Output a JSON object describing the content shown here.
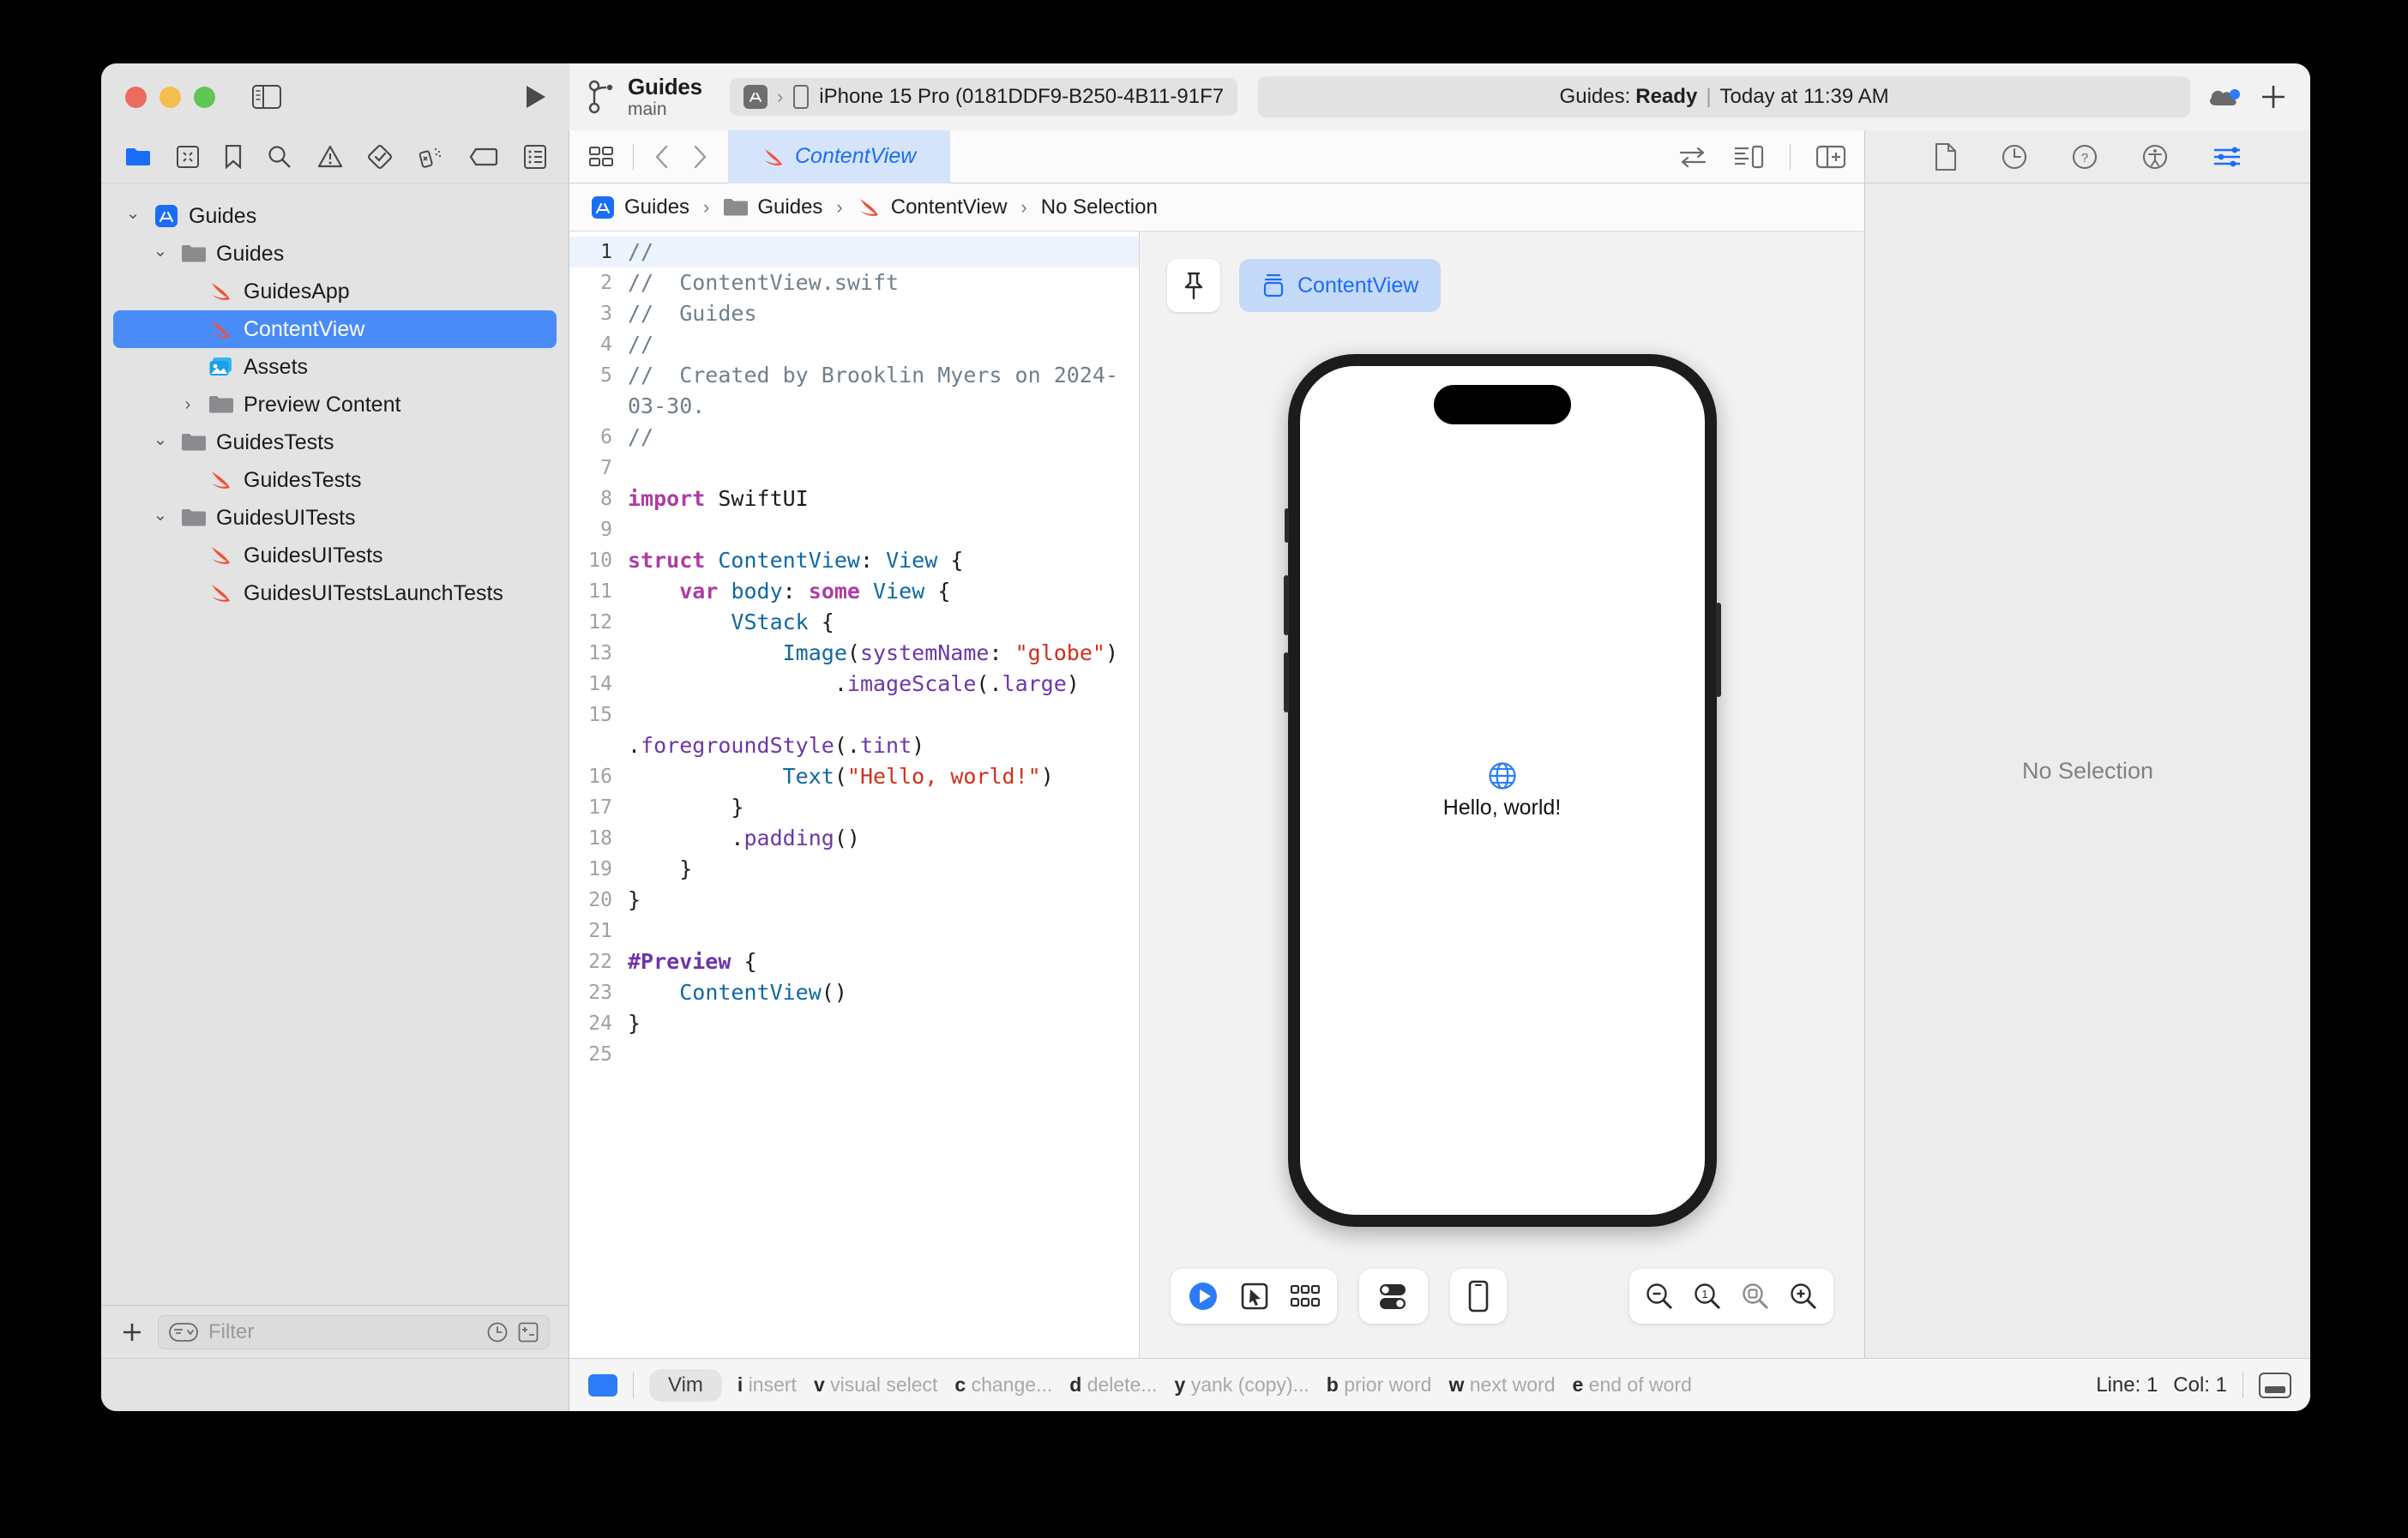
{
  "window": {
    "traffic_lights": [
      "close",
      "minimize",
      "zoom"
    ],
    "scheme_name": "Guides",
    "branch": "main",
    "run_destination": "iPhone 15 Pro (0181DDF9-B250-4B11-91F7",
    "status_prefix": "Guides:",
    "status_state": "Ready",
    "status_separator": "|",
    "status_time": "Today at 11:39 AM",
    "accent_blue": "#2b7cf6"
  },
  "navigator": {
    "toolbar_icons": [
      "folder-icon",
      "source-control-icon",
      "bookmark-icon",
      "search-icon",
      "warning-icon",
      "test-icon",
      "debug-icon",
      "breakpoint-icon",
      "report-icon"
    ],
    "tree": [
      {
        "label": "Guides",
        "icon": "appstore-icon",
        "indent": 0,
        "disclosure": "down",
        "selected": false
      },
      {
        "label": "Guides",
        "icon": "folder-icon",
        "indent": 1,
        "disclosure": "down",
        "selected": false
      },
      {
        "label": "GuidesApp",
        "icon": "swift-icon",
        "indent": 2,
        "disclosure": "none",
        "selected": false
      },
      {
        "label": "ContentView",
        "icon": "swift-icon",
        "indent": 2,
        "disclosure": "none",
        "selected": true
      },
      {
        "label": "Assets",
        "icon": "assets-icon",
        "indent": 2,
        "disclosure": "none",
        "selected": false
      },
      {
        "label": "Preview Content",
        "icon": "folder-icon",
        "indent": 2,
        "disclosure": "right",
        "selected": false
      },
      {
        "label": "GuidesTests",
        "icon": "folder-icon",
        "indent": 1,
        "disclosure": "down",
        "selected": false
      },
      {
        "label": "GuidesTests",
        "icon": "swift-icon",
        "indent": 2,
        "disclosure": "none",
        "selected": false
      },
      {
        "label": "GuidesUITests",
        "icon": "folder-icon",
        "indent": 1,
        "disclosure": "down",
        "selected": false
      },
      {
        "label": "GuidesUITests",
        "icon": "swift-icon",
        "indent": 2,
        "disclosure": "none",
        "selected": false
      },
      {
        "label": "GuidesUITestsLaunchTests",
        "icon": "swift-icon",
        "indent": 2,
        "disclosure": "none",
        "selected": false
      }
    ],
    "filter_placeholder": "Filter",
    "filter_value": ""
  },
  "editor": {
    "tab_label": "ContentView",
    "breadcrumb": [
      "Guides",
      "Guides",
      "ContentView",
      "No Selection"
    ],
    "code_lines": [
      {
        "n": "1",
        "current": true,
        "tokens": [
          {
            "t": "//",
            "c": "comment"
          }
        ]
      },
      {
        "n": "2",
        "current": false,
        "tokens": [
          {
            "t": "//  ContentView.swift",
            "c": "comment"
          }
        ]
      },
      {
        "n": "3",
        "current": false,
        "tokens": [
          {
            "t": "//  Guides",
            "c": "comment"
          }
        ]
      },
      {
        "n": "4",
        "current": false,
        "tokens": [
          {
            "t": "//",
            "c": "comment"
          }
        ]
      },
      {
        "n": "5",
        "current": false,
        "tokens": [
          {
            "t": "//  Created by Brooklin Myers on 2024-03-30.",
            "c": "comment"
          }
        ]
      },
      {
        "n": "6",
        "current": false,
        "tokens": [
          {
            "t": "//",
            "c": "comment"
          }
        ]
      },
      {
        "n": "7",
        "current": false,
        "tokens": []
      },
      {
        "n": "8",
        "current": false,
        "tokens": [
          {
            "t": "import",
            "c": "kw"
          },
          {
            "t": " ",
            "c": "plain"
          },
          {
            "t": "SwiftUI",
            "c": "plain"
          }
        ]
      },
      {
        "n": "9",
        "current": false,
        "tokens": []
      },
      {
        "n": "10",
        "current": false,
        "tokens": [
          {
            "t": "struct",
            "c": "kw"
          },
          {
            "t": " ",
            "c": "plain"
          },
          {
            "t": "ContentView",
            "c": "type"
          },
          {
            "t": ": ",
            "c": "plain"
          },
          {
            "t": "View",
            "c": "type"
          },
          {
            "t": " {",
            "c": "plain"
          }
        ]
      },
      {
        "n": "11",
        "current": false,
        "tokens": [
          {
            "t": "    ",
            "c": "plain"
          },
          {
            "t": "var",
            "c": "kw"
          },
          {
            "t": " ",
            "c": "plain"
          },
          {
            "t": "body",
            "c": "type"
          },
          {
            "t": ": ",
            "c": "plain"
          },
          {
            "t": "some",
            "c": "kw"
          },
          {
            "t": " ",
            "c": "plain"
          },
          {
            "t": "View",
            "c": "type"
          },
          {
            "t": " {",
            "c": "plain"
          }
        ]
      },
      {
        "n": "12",
        "current": false,
        "tokens": [
          {
            "t": "        ",
            "c": "plain"
          },
          {
            "t": "VStack",
            "c": "type"
          },
          {
            "t": " {",
            "c": "plain"
          }
        ]
      },
      {
        "n": "13",
        "current": false,
        "tokens": [
          {
            "t": "            ",
            "c": "plain"
          },
          {
            "t": "Image",
            "c": "type"
          },
          {
            "t": "(",
            "c": "plain"
          },
          {
            "t": "systemName",
            "c": "id"
          },
          {
            "t": ": ",
            "c": "plain"
          },
          {
            "t": "\"globe\"",
            "c": "str"
          },
          {
            "t": ")",
            "c": "plain"
          }
        ]
      },
      {
        "n": "14",
        "current": false,
        "tokens": [
          {
            "t": "                .",
            "c": "plain"
          },
          {
            "t": "imageScale",
            "c": "id"
          },
          {
            "t": "(.",
            "c": "plain"
          },
          {
            "t": "large",
            "c": "id"
          },
          {
            "t": ")",
            "c": "plain"
          }
        ]
      },
      {
        "n": "15",
        "current": false,
        "tokens": [
          {
            "t": "                .",
            "c": "plain"
          },
          {
            "t": "foregroundStyle",
            "c": "id"
          },
          {
            "t": "(.",
            "c": "plain"
          },
          {
            "t": "tint",
            "c": "id"
          },
          {
            "t": ")",
            "c": "plain"
          }
        ]
      },
      {
        "n": "16",
        "current": false,
        "tokens": [
          {
            "t": "            ",
            "c": "plain"
          },
          {
            "t": "Text",
            "c": "type"
          },
          {
            "t": "(",
            "c": "plain"
          },
          {
            "t": "\"Hello, world!\"",
            "c": "str"
          },
          {
            "t": ")",
            "c": "plain"
          }
        ]
      },
      {
        "n": "17",
        "current": false,
        "tokens": [
          {
            "t": "        }",
            "c": "plain"
          }
        ]
      },
      {
        "n": "18",
        "current": false,
        "tokens": [
          {
            "t": "        .",
            "c": "plain"
          },
          {
            "t": "padding",
            "c": "id"
          },
          {
            "t": "()",
            "c": "plain"
          }
        ]
      },
      {
        "n": "19",
        "current": false,
        "tokens": [
          {
            "t": "    }",
            "c": "plain"
          }
        ]
      },
      {
        "n": "20",
        "current": false,
        "tokens": [
          {
            "t": "}",
            "c": "plain"
          }
        ]
      },
      {
        "n": "21",
        "current": false,
        "tokens": []
      },
      {
        "n": "22",
        "current": false,
        "tokens": [
          {
            "t": "#Preview",
            "c": "prep"
          },
          {
            "t": " {",
            "c": "plain"
          }
        ]
      },
      {
        "n": "23",
        "current": false,
        "tokens": [
          {
            "t": "    ",
            "c": "plain"
          },
          {
            "t": "ContentView",
            "c": "type"
          },
          {
            "t": "()",
            "c": "plain"
          }
        ]
      },
      {
        "n": "24",
        "current": false,
        "tokens": [
          {
            "t": "}",
            "c": "plain"
          }
        ]
      },
      {
        "n": "25",
        "current": false,
        "tokens": []
      }
    ],
    "right_icons": [
      "swap-editors-icon",
      "canvas-layout-icon",
      "add-editor-icon"
    ]
  },
  "canvas": {
    "pin_icon": "pin-icon",
    "preview_label": "ContentView",
    "preview_content": {
      "image_icon": "globe-icon",
      "text": "Hello, world!"
    },
    "controls": [
      "play-icon",
      "select-icon",
      "variants-icon",
      "toggles-icon",
      "device-icon"
    ],
    "zoom_controls": [
      "zoom-out-icon",
      "zoom-actual-icon",
      "zoom-fit-icon",
      "zoom-in-icon"
    ]
  },
  "inspector": {
    "toolbar_icons": [
      "file-inspector-icon",
      "history-inspector-icon",
      "help-inspector-icon",
      "accessibility-inspector-icon",
      "attributes-inspector-icon"
    ],
    "active_icon": "attributes-inspector-icon",
    "empty_text": "No Selection"
  },
  "statusbar": {
    "mode_label": "Vim",
    "hints": [
      {
        "key": "i",
        "desc": "insert"
      },
      {
        "key": "v",
        "desc": "visual select"
      },
      {
        "key": "c",
        "desc": "change..."
      },
      {
        "key": "d",
        "desc": "delete..."
      },
      {
        "key": "y",
        "desc": "yank (copy)..."
      },
      {
        "key": "b",
        "desc": "prior word"
      },
      {
        "key": "w",
        "desc": "next word"
      },
      {
        "key": "e",
        "desc": "end of word"
      }
    ],
    "line_label": "Line: 1",
    "col_label": "Col: 1"
  }
}
